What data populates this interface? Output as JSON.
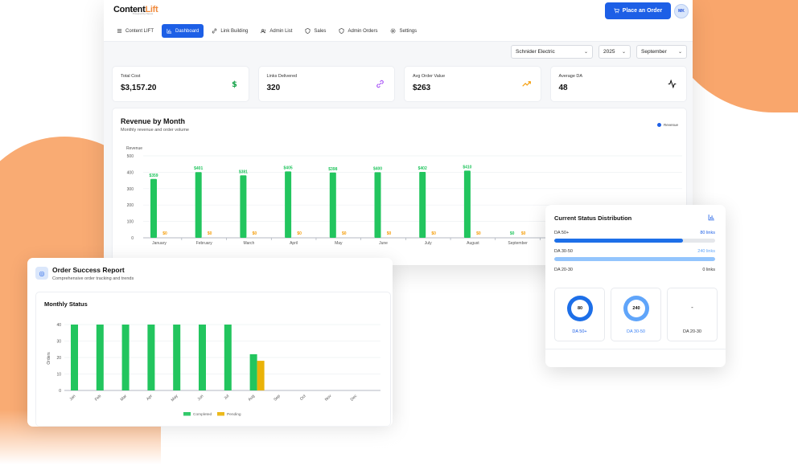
{
  "brand": {
    "name_main": "Content",
    "name_accent": "Lift",
    "tagline": "Powered by Nexus"
  },
  "header": {
    "place_order_label": "Place an Order",
    "avatar_initials": "MK"
  },
  "nav": [
    {
      "label": "Content LIFT",
      "icon": "list-icon",
      "active": false
    },
    {
      "label": "Dashboard",
      "icon": "bar-chart-icon",
      "active": true
    },
    {
      "label": "Link Building",
      "icon": "link-icon",
      "active": false
    },
    {
      "label": "Admin List",
      "icon": "users-icon",
      "active": false
    },
    {
      "label": "Sales",
      "icon": "shield-icon",
      "active": false
    },
    {
      "label": "Admin Orders",
      "icon": "shield-icon",
      "active": false
    },
    {
      "label": "Settings",
      "icon": "gear-icon",
      "active": false
    }
  ],
  "filters": {
    "client": "Schnider Electric",
    "year": "2025",
    "month": "September"
  },
  "stats": [
    {
      "label": "Total Cost",
      "value": "$3,157.20",
      "icon": "dollar-icon",
      "color": "#16a34a"
    },
    {
      "label": "Links Delivered",
      "value": "320",
      "icon": "link-icon",
      "color": "#a855f7"
    },
    {
      "label": "Avg Order Value",
      "value": "$263",
      "icon": "trending-up-icon",
      "color": "#f59e0b"
    },
    {
      "label": "Average DA",
      "value": "48",
      "icon": "activity-icon",
      "color": "#111111"
    }
  ],
  "revenue": {
    "title": "Revenue by Month",
    "subtitle": "Monthly revenue and order volume",
    "legend": "Revenue"
  },
  "status": {
    "title": "Current Status Distribution",
    "rows": [
      {
        "label": "DA 50+",
        "value": "80 links",
        "fraction": 0.8,
        "color": "#1d6fe8"
      },
      {
        "label": "DA 30-50",
        "value": "240 links",
        "fraction": 1.0,
        "color": "#93c5fd"
      },
      {
        "label": "DA 20-30",
        "value": "0 links",
        "fraction": 0,
        "color": "#e5e7eb"
      }
    ],
    "donuts": [
      {
        "label": "DA 50+",
        "value": "80",
        "color": "#1d6fe8"
      },
      {
        "label": "DA 30-50",
        "value": "240",
        "color": "#60a5fa"
      },
      {
        "label": "DA 20-30",
        "value": "-",
        "color": ""
      }
    ]
  },
  "order": {
    "title": "Order Success Report",
    "subtitle": "Comprehensive order tracking and trends",
    "monthly_title": "Monthly Status"
  },
  "chart_data": [
    {
      "type": "bar",
      "ylabel": "Revenue",
      "ylim": [
        0,
        500
      ],
      "yticks": [
        0,
        100,
        200,
        300,
        400,
        500
      ],
      "categories": [
        "January",
        "February",
        "March",
        "April",
        "May",
        "June",
        "July",
        "August",
        "September"
      ],
      "series": [
        {
          "name": "Revenue",
          "color": "#22c55e",
          "values": [
            359,
            401,
            381,
            405,
            398,
            400,
            402,
            410,
            0
          ],
          "labels": [
            "$359",
            "$401",
            "$381",
            "$405",
            "$398",
            "$400",
            "$402",
            "$410",
            "$0"
          ]
        },
        {
          "color": "#f59e0b",
          "values": [
            0,
            0,
            0,
            0,
            0,
            0,
            0,
            0,
            0
          ],
          "labels": [
            "$0",
            "$0",
            "$0",
            "$0",
            "$0",
            "$0",
            "$0",
            "$0",
            "$0"
          ]
        }
      ]
    },
    {
      "type": "bar",
      "ylabel": "Orders",
      "ylim": [
        0,
        40
      ],
      "yticks": [
        0,
        10,
        20,
        30,
        40
      ],
      "categories": [
        "Jan",
        "Feb",
        "Mar",
        "Apr",
        "May",
        "Jun",
        "Jul",
        "Aug",
        "Sep",
        "Oct",
        "Nov",
        "Dec"
      ],
      "series": [
        {
          "name": "Completed",
          "color": "#22c55e",
          "values": [
            40,
            40,
            40,
            40,
            40,
            40,
            40,
            22,
            0,
            0,
            0,
            0
          ]
        },
        {
          "name": "Pending",
          "color": "#eab308",
          "values": [
            0,
            0,
            0,
            0,
            0,
            0,
            0,
            18,
            0,
            0,
            0,
            0
          ]
        }
      ],
      "legend": [
        "Completed",
        "Pending"
      ]
    }
  ]
}
